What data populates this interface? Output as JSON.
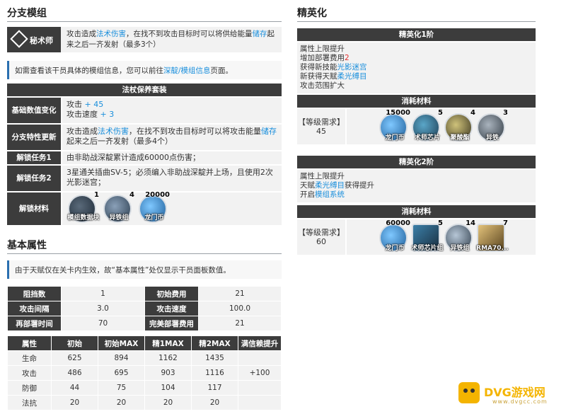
{
  "left": {
    "branch_title": "分支模组",
    "branch_name": "秘术师",
    "branch_desc_a": "攻击造成",
    "branch_desc_magic": "法术伤害",
    "branch_desc_b": "，在找不到攻击目标时可以将供给能量",
    "branch_desc_store": "储存",
    "branch_desc_c": "起来之后一齐发射（最多3个）",
    "module_note_a": "如需查看该干员具体的模组信息，您可以前往",
    "module_note_link": "深靛/模组信息",
    "module_note_b": "页面。",
    "module_name": "法杖保养套装",
    "rows": {
      "stat_label": "基础数值变化",
      "stat_atk": "攻击",
      "stat_atk_val": "+ 45",
      "stat_aspd": "攻击速度",
      "stat_aspd_val": "+ 3",
      "trait_label": "分支特性更新",
      "trait_a": "攻击造成",
      "trait_magic": "法术伤害",
      "trait_b": "，在找不到攻击目标时可以将攻击能量",
      "trait_store": "储存",
      "trait_c": "起来之后一齐发射（最多4个）",
      "task1_label": "解锁任务1",
      "task1_text": "由非助战深靛累计造成60000点伤害；",
      "task2_label": "解锁任务2",
      "task2_text": "3星通关插曲SV-5；必须编入非助战深靛并上场，且使用2次光影迷宫；",
      "mat_label": "解锁材料"
    },
    "module_items": [
      {
        "count": "1",
        "name": "模组数据块",
        "icon": "data-block-icon"
      },
      {
        "count": "4",
        "name": "异铁组",
        "icon": "orirock-icon"
      },
      {
        "count": "20000",
        "name": "龙门币",
        "icon": "lmd-icon"
      }
    ],
    "attr_title": "基本属性",
    "attr_note": "由于天赋仅在关卡内生效，故“基本属性”处仅显示干员面板数值。",
    "info": [
      {
        "k1": "阻挡数",
        "v1": "1",
        "k2": "初始费用",
        "v2": "21"
      },
      {
        "k1": "攻击间隔",
        "v1": "3.0",
        "k2": "攻击速度",
        "v2": "100.0"
      },
      {
        "k1": "再部署时间",
        "v1": "70",
        "k2": "完美部署费用",
        "v2": "21"
      }
    ],
    "stat_headers": [
      "属性",
      "初始",
      "初始MAX",
      "精1MAX",
      "精2MAX",
      "满信赖提升"
    ],
    "stat_rows": [
      [
        "生命",
        "625",
        "894",
        "1162",
        "1435",
        ""
      ],
      [
        "攻击",
        "486",
        "695",
        "903",
        "1116",
        "+100"
      ],
      [
        "防御",
        "44",
        "75",
        "104",
        "117",
        ""
      ],
      [
        "法抗",
        "20",
        "20",
        "20",
        "20",
        ""
      ]
    ]
  },
  "right": {
    "title": "精英化",
    "e1_title": "精英化1阶",
    "e1_lines": [
      "属性上限提升"
    ],
    "e1_cost_a": "增加部署费用",
    "e1_cost_val": "2",
    "e1_skill_a": "获得新技能",
    "e1_skill": "光影迷宫",
    "e1_talent_a": "新获得天赋",
    "e1_talent": "柔光缚目",
    "e1_range": "攻击范围扩大",
    "mat_title": "消耗材料",
    "req_label": "【等级需求】",
    "e1_req": "45",
    "e1_items": [
      {
        "count": "15000",
        "name": "龙门币",
        "icon": "lmd-icon"
      },
      {
        "count": "5",
        "name": "术师芯片",
        "icon": "caster-chip-icon"
      },
      {
        "count": "4",
        "name": "聚酸酯",
        "icon": "polyester-icon"
      },
      {
        "count": "3",
        "name": "异铁",
        "icon": "oriron-icon"
      }
    ],
    "e2_title": "精英化2阶",
    "e2_line1": "属性上限提升",
    "e2_talent_a": "天赋",
    "e2_talent": "柔光缚目",
    "e2_talent_b": "获得提升",
    "e2_mod_a": "开启",
    "e2_mod": "模组系统",
    "e2_req": "60",
    "e2_items": [
      {
        "count": "60000",
        "name": "龙门币",
        "icon": "lmd-icon"
      },
      {
        "count": "5",
        "name": "术师芯片组",
        "icon": "caster-chipset-icon"
      },
      {
        "count": "14",
        "name": "异铁组",
        "icon": "oriron-cluster-icon"
      },
      {
        "count": "7",
        "name": "RMA70...",
        "icon": "rma-icon"
      }
    ]
  },
  "watermark": {
    "brand": "DVG游戏网",
    "url": "www.dvgcc.com"
  }
}
